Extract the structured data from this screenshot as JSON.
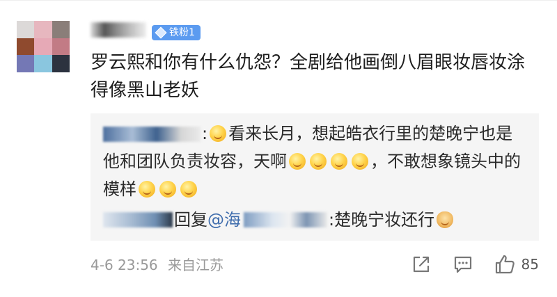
{
  "comment": {
    "badge_label": "铁粉1",
    "text": "罗云熙和你有什么仇怨？全剧给他画倒八眉眼妆唇妆涂得像黑山老妖",
    "avatar_colors": [
      "#dcd9d8",
      "#e7b7bf",
      "#8a7e79",
      "#8f4a2e",
      "#e6a9b6",
      "#c27b85",
      "#7478b5",
      "#8ac6df",
      "#2c323f"
    ]
  },
  "replies": [
    {
      "text_a": "看来长月，想起皓衣行里的楚晚宁也是他和团队负责妆容，天啊",
      "text_b": "，不敢想象镜头中的模样"
    },
    {
      "reply_word": "回复",
      "mention": "@海",
      "text": "楚晚宁妆还行"
    }
  ],
  "footer": {
    "time": "4-6 23:56",
    "location": "来自江苏",
    "like_count": "85"
  },
  "icons": {
    "badge": "diamond-icon",
    "share": "share-icon",
    "comment": "comment-icon",
    "like": "thumbs-up-icon"
  }
}
